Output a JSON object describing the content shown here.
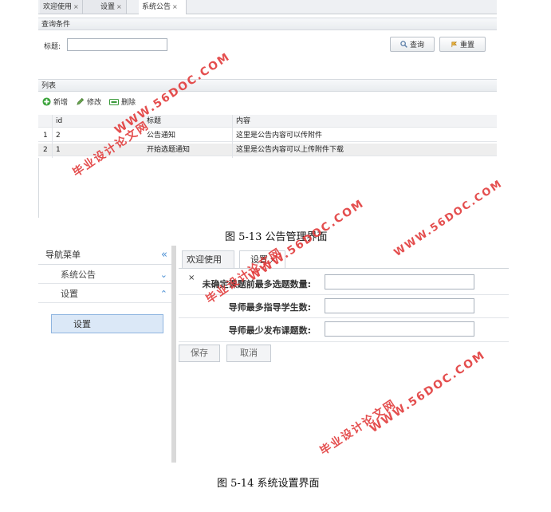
{
  "figure1": {
    "tabs": [
      "欢迎使用",
      "设置",
      "系统公告"
    ],
    "close_mark": "×",
    "query_section": "查询条件",
    "title_label": "标题:",
    "title_value": "",
    "query_button": "查询",
    "reset_button": "重置",
    "list_section": "列表",
    "toolbar": {
      "add": "新增",
      "edit": "修改",
      "delete": "删除"
    },
    "columns": [
      "id",
      "标题",
      "内容"
    ],
    "rows": [
      {
        "num": "1",
        "id": "2",
        "title": "公告通知",
        "content": "这里是公告内容可以传附件"
      },
      {
        "num": "2",
        "id": "1",
        "title": "开始选题通知",
        "content": "这里是公告内容可以上传附件下载"
      }
    ],
    "caption": "图 5-13 公告管理界面"
  },
  "figure2": {
    "nav_title": "导航菜单",
    "nav_items": [
      "系统公告",
      "设置"
    ],
    "nav_selected": "设置",
    "tabs": [
      "欢迎使用",
      "设置"
    ],
    "close_mark": "×",
    "fields": [
      {
        "label": "未确定课题前最多选题数量:",
        "value": ""
      },
      {
        "label": "导师最多指导学生数:",
        "value": ""
      },
      {
        "label": "导师最少发布课题数:",
        "value": ""
      }
    ],
    "save_button": "保存",
    "cancel_button": "取消",
    "caption": "图 5-14 系统设置界面"
  },
  "watermarks": [
    {
      "line1": "WWW.56DOC.COM",
      "line2": "毕业设计论文网"
    }
  ],
  "colors": {
    "watermark": "#e23b3b",
    "nav_accent": "#4a8fd4",
    "selected_bg": "#dbe8f7"
  }
}
